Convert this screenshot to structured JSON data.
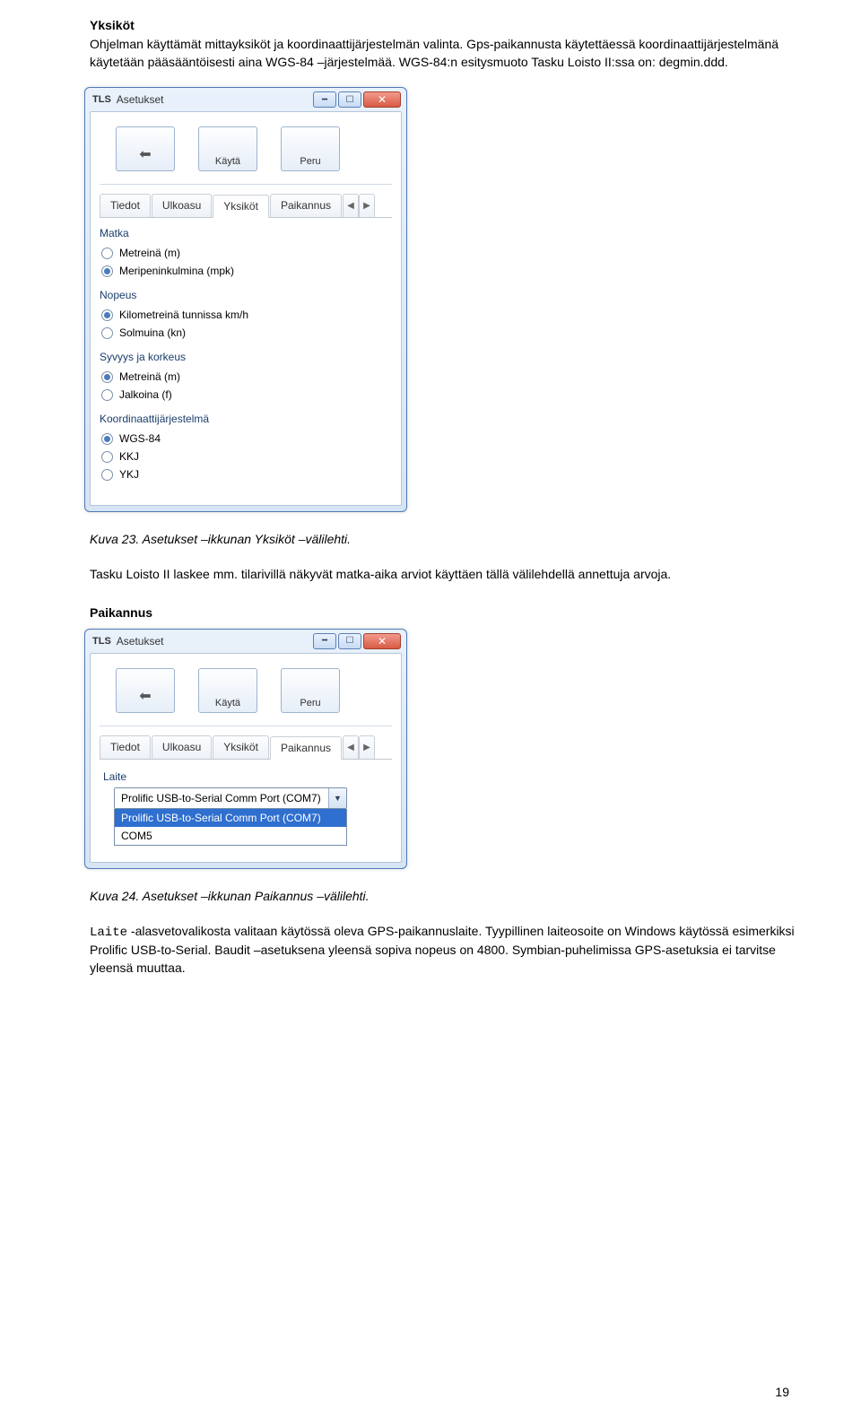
{
  "heading1": "Yksiköt",
  "para1": "Ohjelman käyttämät mittayksiköt ja koordinaattijärjestelmän valinta. Gps-paikannusta käytettäessä koordinaattijärjestelmänä käytetään pääsääntöisesti aina WGS-84 –järjestelmää. WGS-84:n esitysmuoto Tasku Loisto II:ssa on: degmin.ddd.",
  "window": {
    "app_sigil": "TLS",
    "title": "Asetukset",
    "toolbar": {
      "back": "",
      "use": "Käytä",
      "undo": "Peru"
    },
    "tabs": {
      "t1": "Tiedot",
      "t2": "Ulkoasu",
      "t3": "Yksiköt",
      "t4": "Paikannus"
    },
    "groups": {
      "matka": {
        "title": "Matka",
        "opt1": "Metreinä (m)",
        "opt2": "Meripeninkulmina (mpk)"
      },
      "nopeus": {
        "title": "Nopeus",
        "opt1": "Kilometreinä tunnissa km/h",
        "opt2": "Solmuina (kn)"
      },
      "syvyys": {
        "title": "Syvyys ja korkeus",
        "opt1": "Metreinä (m)",
        "opt2": "Jalkoina (f)"
      },
      "koord": {
        "title": "Koordinaattijärjestelmä",
        "opt1": "WGS-84",
        "opt2": "KKJ",
        "opt3": "YKJ"
      }
    }
  },
  "caption1": "Kuva 23. Asetukset –ikkunan Yksiköt –välilehti.",
  "para2": "Tasku Loisto II laskee mm. tilarivillä näkyvät matka-aika arviot käyttäen tällä välilehdellä annettuja arvoja.",
  "heading2": "Paikannus",
  "window2": {
    "group_laite": "Laite",
    "combo_value": "Prolific USB-to-Serial Comm Port (COM7)",
    "combo_opt_sel": "Prolific USB-to-Serial Comm Port (COM7)",
    "combo_opt2": "COM5"
  },
  "caption2": "Kuva 24. Asetukset –ikkunan Paikannus –välilehti.",
  "para3a": "Laite",
  "para3b": " -alasvetovalikosta valitaan käytössä oleva GPS-paikannuslaite. Tyypillinen laiteosoite on Windows käytössä esimerkiksi Prolific USB-to-Serial. Baudit –asetuksena yleensä sopiva nopeus on 4800. Symbian-puhelimissa GPS-asetuksia ei tarvitse yleensä muuttaa.",
  "page_num": "19"
}
